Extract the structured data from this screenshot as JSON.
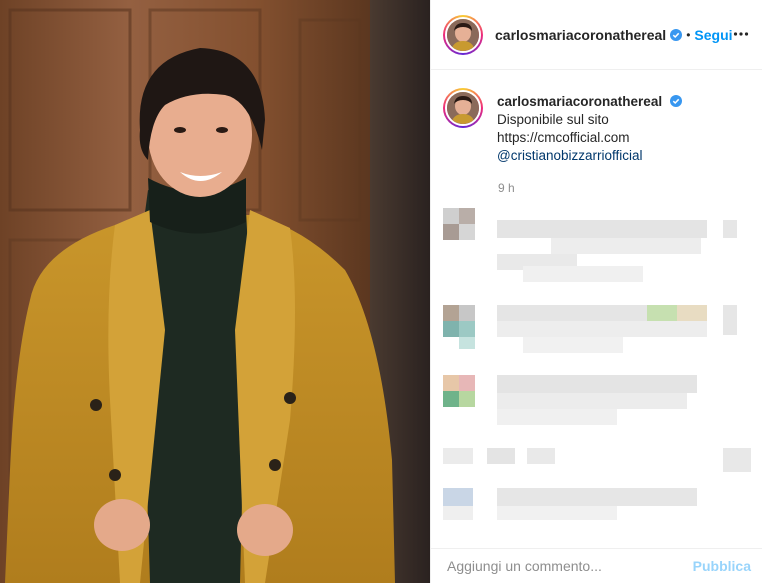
{
  "header": {
    "username": "carlosmariacoronathereal",
    "separator": "•",
    "follow_label": "Segui",
    "avatar_icon": "profile-avatar-icon",
    "more_icon": "more-options-icon"
  },
  "caption": {
    "username": "carlosmariacoronathereal",
    "line1": "Disponibile sul sito",
    "link": "https://cmcofficial.com",
    "mention": "@cristianobizzarriofficial",
    "time": "9 h"
  },
  "comment_box": {
    "placeholder": "Aggiungi un commento...",
    "publish_label": "Pubblica"
  },
  "colors": {
    "accent": "#0095f6",
    "verified": "#3897f0",
    "mention": "#00376b",
    "muted": "#8e8e8e"
  }
}
